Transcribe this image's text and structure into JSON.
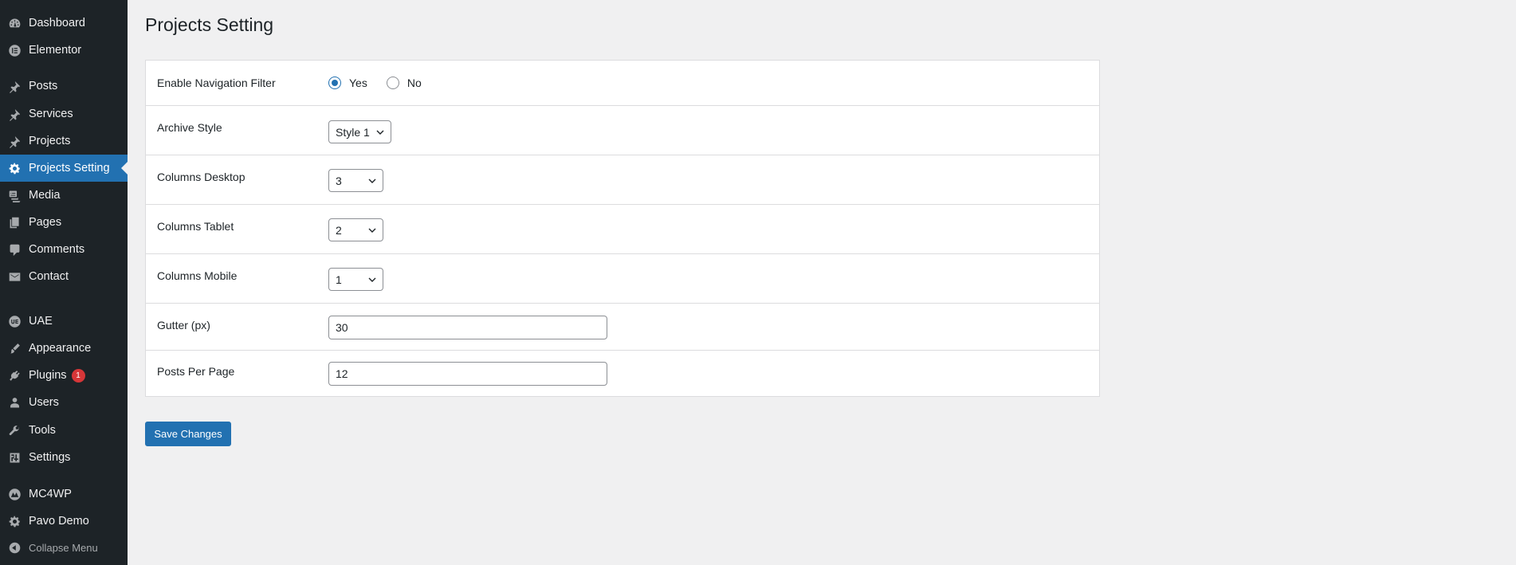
{
  "sidebar": {
    "items": [
      {
        "label": "Dashboard",
        "icon": "dashboard-icon"
      },
      {
        "label": "Elementor",
        "icon": "elementor-icon"
      },
      {
        "label": "Posts",
        "icon": "pin-icon"
      },
      {
        "label": "Services",
        "icon": "pin-icon"
      },
      {
        "label": "Projects",
        "icon": "pin-icon"
      },
      {
        "label": "Projects Setting",
        "icon": "gear-icon"
      },
      {
        "label": "Media",
        "icon": "media-icon"
      },
      {
        "label": "Pages",
        "icon": "pages-icon"
      },
      {
        "label": "Comments",
        "icon": "comment-icon"
      },
      {
        "label": "Contact",
        "icon": "mail-icon"
      },
      {
        "label": "UAE",
        "icon": "uae-icon"
      },
      {
        "label": "Appearance",
        "icon": "brush-icon"
      },
      {
        "label": "Plugins",
        "icon": "plugin-icon",
        "badge": "1"
      },
      {
        "label": "Users",
        "icon": "user-icon"
      },
      {
        "label": "Tools",
        "icon": "wrench-icon"
      },
      {
        "label": "Settings",
        "icon": "settings-icon"
      },
      {
        "label": "MC4WP",
        "icon": "mc4wp-icon"
      },
      {
        "label": "Pavo Demo",
        "icon": "gear-icon"
      },
      {
        "label": "Collapse Menu",
        "icon": "collapse-icon"
      }
    ],
    "active": "Projects Setting"
  },
  "page": {
    "title": "Projects Setting"
  },
  "settings": {
    "navigation_filter": {
      "label": "Enable Navigation Filter",
      "options": [
        "Yes",
        "No"
      ],
      "selected": "Yes"
    },
    "archive_style": {
      "label": "Archive Style",
      "value": "Style 1"
    },
    "columns_desktop": {
      "label": "Columns Desktop",
      "value": "3"
    },
    "columns_tablet": {
      "label": "Columns Tablet",
      "value": "2"
    },
    "columns_mobile": {
      "label": "Columns Mobile",
      "value": "1"
    },
    "gutter": {
      "label": "Gutter (px)",
      "value": "30"
    },
    "posts_per_page": {
      "label": "Posts Per Page",
      "value": "12"
    }
  },
  "actions": {
    "save_label": "Save Changes"
  },
  "colors": {
    "sidebar_bg": "#1d2327",
    "accent": "#2271b1",
    "badge": "#d63638",
    "page_bg": "#f0f0f1"
  }
}
